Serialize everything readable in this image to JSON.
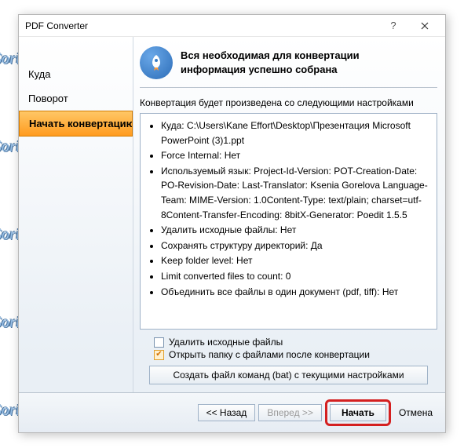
{
  "watermark": "Soringpcrepair.com",
  "window": {
    "title": "PDF Converter",
    "help": "?",
    "close": "×"
  },
  "sidebar": {
    "items": [
      {
        "label": "Куда"
      },
      {
        "label": "Поворот"
      },
      {
        "label": "Начать конвертацию"
      }
    ]
  },
  "header": {
    "line1": "Вся необходимая для конвертации",
    "line2": "информация успешно собрана"
  },
  "summary": {
    "label": "Конвертация будет произведена со следующими настройками",
    "items": [
      "Куда: C:\\Users\\Kane Effort\\Desktop\\Презентация Microsoft PowerPoint (3)1.ppt",
      "Force Internal: Нет",
      "Используемый язык: Project-Id-Version: POT-Creation-Date: PO-Revision-Date: Last-Translator: Ksenia Gorelova Language-Team: MIME-Version: 1.0Content-Type: text/plain; charset=utf-8Content-Transfer-Encoding: 8bitX-Generator: Poedit 1.5.5",
      "Удалить исходные файлы: Нет",
      "Сохранять структуру директорий: Да",
      "Keep folder level: Нет",
      "Limit converted files to count: 0",
      "Объединить все файлы в один документ (pdf, tiff): Нет"
    ]
  },
  "options": {
    "delete_source": {
      "label": "Удалить исходные файлы",
      "checked": false
    },
    "open_folder": {
      "label": "Открыть папку с файлами после конвертации",
      "checked": true
    }
  },
  "bat_button": "Создать файл команд (bat) с текущими настройками",
  "footer": {
    "back": "<< Назад",
    "forward": "Вперед >>",
    "start": "Начать",
    "cancel": "Отмена"
  }
}
